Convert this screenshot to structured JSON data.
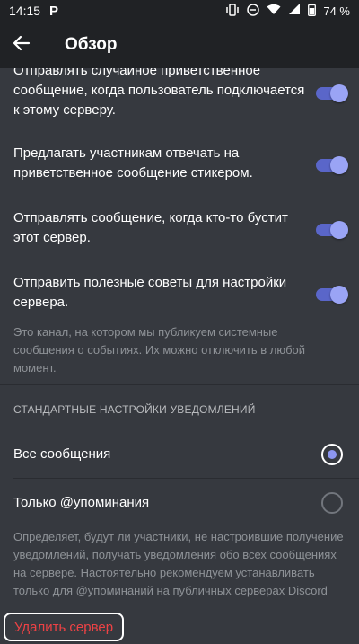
{
  "status_bar": {
    "time": "14:15",
    "app_icon": "P",
    "battery_text": "74 %",
    "icons": [
      "vibrate-icon",
      "dnd-icon",
      "wifi-icon",
      "signal-icon",
      "battery-icon"
    ]
  },
  "toolbar": {
    "title": "Обзор",
    "back_icon": "arrow-left-icon"
  },
  "settings": [
    {
      "label": "Отправлять случайное приветственное сообщение, когда пользователь подключается к этому серверу.",
      "enabled": true
    },
    {
      "label": "Предлагать участникам отвечать на приветственное сообщение стикером.",
      "enabled": true
    },
    {
      "label": "Отправлять сообщение, когда кто-то бустит этот сервер.",
      "enabled": true
    },
    {
      "label": "Отправить полезные советы для настройки сервера.",
      "enabled": true
    }
  ],
  "system_channel_help": "Это канал, на котором мы публикуем системные сообщения о событиях. Их можно отключить в любой момент.",
  "notifications": {
    "header": "СТАНДАРТНЫЕ НАСТРОЙКИ УВЕДОМЛЕНИЙ",
    "options": [
      {
        "label": "Все сообщения",
        "selected": true
      },
      {
        "label": "Только @упоминания",
        "selected": false
      }
    ],
    "help": "Определяет, будут ли участники, не настроившие получение уведомлений, получать уведомления обо всех сообщениях на сервере. Настоятельно рекомендуем устанавливать только для @упоминаний на публичных серверах Discord"
  },
  "delete_server": "Удалить сервер",
  "colors": {
    "background": "#36393f",
    "toolbar": "#202225",
    "accent": "#5865f2",
    "danger": "#ed4245",
    "muted_text": "#8e9297"
  }
}
